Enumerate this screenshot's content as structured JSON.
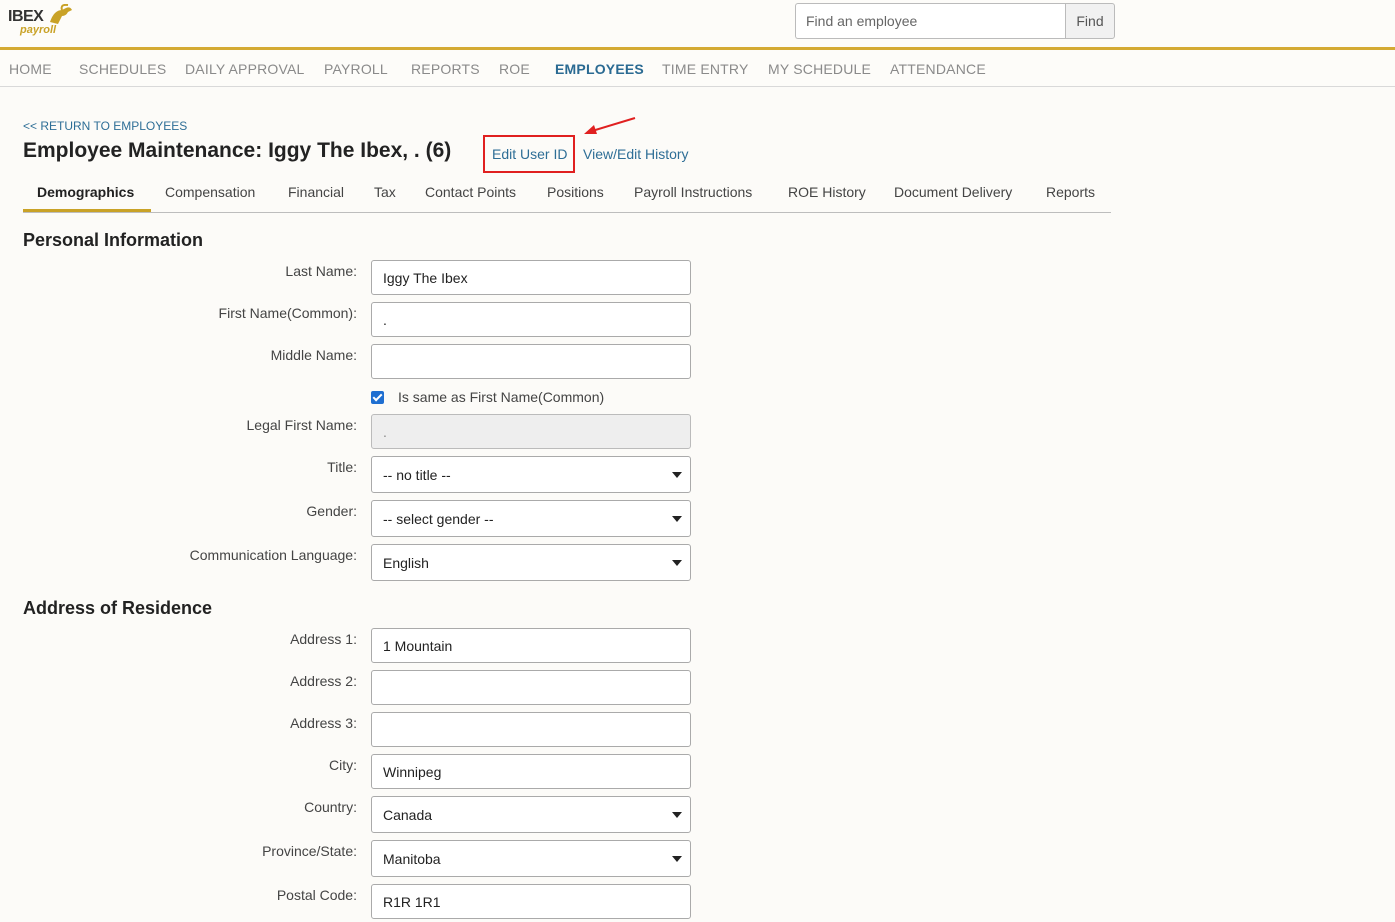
{
  "header": {
    "logo_text": "IBEX",
    "logo_sub": "payroll",
    "search_placeholder": "Find an employee",
    "find_label": "Find"
  },
  "nav": [
    {
      "label": "HOME"
    },
    {
      "label": "SCHEDULES"
    },
    {
      "label": "DAILY APPROVAL"
    },
    {
      "label": "PAYROLL"
    },
    {
      "label": "REPORTS"
    },
    {
      "label": "ROE"
    },
    {
      "label": "EMPLOYEES",
      "active": true
    },
    {
      "label": "TIME ENTRY"
    },
    {
      "label": "MY SCHEDULE"
    },
    {
      "label": "ATTENDANCE"
    }
  ],
  "page": {
    "return_link": "<< RETURN TO EMPLOYEES",
    "title": "Employee Maintenance:  Iggy The Ibex, . (6)",
    "edit_user_id": "Edit User ID",
    "view_edit_history": "View/Edit History"
  },
  "tabs": [
    {
      "label": "Demographics",
      "active": true
    },
    {
      "label": "Compensation"
    },
    {
      "label": "Financial"
    },
    {
      "label": "Tax"
    },
    {
      "label": "Contact Points"
    },
    {
      "label": "Positions"
    },
    {
      "label": "Payroll Instructions"
    },
    {
      "label": "ROE History"
    },
    {
      "label": "Document Delivery"
    },
    {
      "label": "Reports"
    }
  ],
  "personal": {
    "section_title": "Personal Information",
    "last_name_label": "Last Name:",
    "last_name_value": "Iggy The Ibex",
    "first_name_label": "First Name(Common):",
    "first_name_value": ".",
    "middle_name_label": "Middle Name:",
    "middle_name_value": "",
    "same_as_label": "Is same as First Name(Common)",
    "same_as_checked": true,
    "legal_first_label": "Legal First Name:",
    "legal_first_value": ".",
    "title_label": "Title:",
    "title_value": "-- no title --",
    "gender_label": "Gender:",
    "gender_value": "-- select gender --",
    "language_label": "Communication Language:",
    "language_value": "English"
  },
  "address": {
    "section_title": "Address of Residence",
    "address1_label": "Address 1:",
    "address1_value": "1 Mountain",
    "address2_label": "Address 2:",
    "address2_value": "",
    "address3_label": "Address 3:",
    "address3_value": "",
    "city_label": "City:",
    "city_value": "Winnipeg",
    "country_label": "Country:",
    "country_value": "Canada",
    "province_label": "Province/State:",
    "province_value": "Manitoba",
    "postal_label": "Postal Code:",
    "postal_value": "R1R 1R1"
  },
  "colors": {
    "accent_gold": "#d4aa33",
    "link_blue": "#2e6e96",
    "highlight_red": "#e02020"
  }
}
